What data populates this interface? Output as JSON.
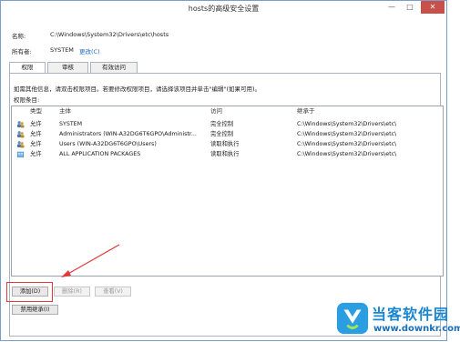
{
  "window": {
    "title": "hosts的高级安全设置",
    "min_glyph": "—",
    "max_glyph": "□",
    "close_glyph": "✕"
  },
  "info": {
    "name_label": "名称:",
    "name_value": "C:\\Windows\\System32\\Drivers\\etc\\hosts",
    "owner_label": "所有者:",
    "owner_value": "SYSTEM",
    "change_link": "更改(C)"
  },
  "tabs": [
    {
      "label": "权限",
      "active": true
    },
    {
      "label": "审核",
      "active": false
    },
    {
      "label": "有效访问",
      "active": false
    }
  ],
  "panel": {
    "hint": "如需其他信息，请双击权限项目。若要修改权限项目，请选择该项目并单击\"编辑\"(如果可用)。",
    "entries_label": "权限条目:"
  },
  "grid": {
    "headers": {
      "type": "类型",
      "principal": "主体",
      "access": "访问",
      "inherited": "继承于"
    },
    "rows": [
      {
        "icon": "user-group-icon",
        "type": "允许",
        "principal": "SYSTEM",
        "access": "完全控制",
        "inherited": "C:\\Windows\\System32\\Drivers\\etc\\"
      },
      {
        "icon": "user-group-icon",
        "type": "允许",
        "principal": "Administrators (WIN-A32DG6T6GPO\\Administr...",
        "access": "完全控制",
        "inherited": "C:\\Windows\\System32\\Drivers\\etc\\"
      },
      {
        "icon": "user-group-icon",
        "type": "允许",
        "principal": "Users (WIN-A32DG6T6GPO\\Users)",
        "access": "读取和执行",
        "inherited": "C:\\Windows\\System32\\Drivers\\etc\\"
      },
      {
        "icon": "app-packages-icon",
        "type": "允许",
        "principal": "ALL APPLICATION PACKAGES",
        "access": "读取和执行",
        "inherited": "C:\\Windows\\System32\\Drivers\\etc\\"
      }
    ]
  },
  "buttons": {
    "add": "添加(D)",
    "remove": "删除(R)",
    "view": "查看(V)",
    "disable_inheritance": "禁用继承(I)"
  },
  "watermark": {
    "title": "当客软件园",
    "url": "www.downkr.com"
  },
  "colors": {
    "annotation_red": "#e23a3a",
    "link_blue": "#1c6dc8",
    "watermark_blue": "#1a86d0"
  }
}
